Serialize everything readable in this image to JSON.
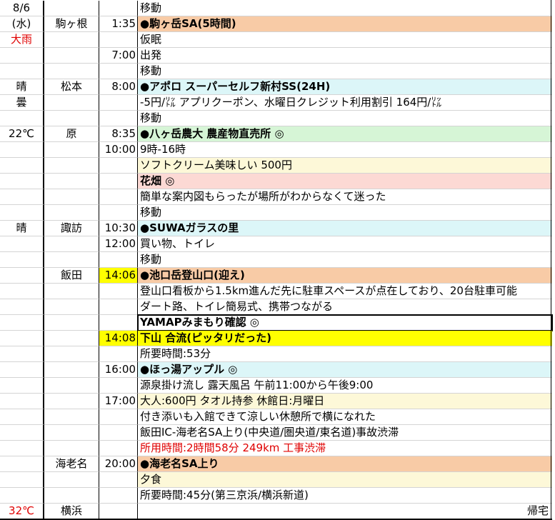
{
  "rows": [
    {
      "c1": "8/6",
      "c2": "",
      "c3": "",
      "c4": "移動",
      "bg4": "",
      "bg3": ""
    },
    {
      "c1": "(水)",
      "c2": "駒ヶ根",
      "c3": "1:35",
      "c4": "●駒ヶ岳SA(5時間)",
      "bg4": "#f8cba6",
      "bg3": "",
      "bold4": true
    },
    {
      "c1": "大雨",
      "c2": "",
      "c3": "",
      "c4": "仮眠",
      "bg4": "",
      "bg3": "",
      "red1": true
    },
    {
      "c1": "",
      "c2": "",
      "c3": "7:00",
      "c4": "出発",
      "bg4": "",
      "bg3": ""
    },
    {
      "c1": "",
      "c2": "",
      "c3": "",
      "c4": "移動",
      "bg4": "",
      "bg3": ""
    },
    {
      "c1": "晴",
      "c2": "松本",
      "c3": "8:00",
      "c4": "●アポロ スーパーセルフ新村SS(24H)",
      "bg4": "#dcf6f8",
      "bg3": "",
      "bold4": true
    },
    {
      "c1": "曇",
      "c2": "",
      "c3": "",
      "c4": "-5円/㍑ アプリクーポン、水曜日クレジット利用割引 164円/㍑",
      "bg4": "",
      "bg3": ""
    },
    {
      "c1": "",
      "c2": "",
      "c3": "",
      "c4": "移動",
      "bg4": "",
      "bg3": ""
    },
    {
      "c1": "22℃",
      "c2": "原",
      "c3": "8:35",
      "c4": "●八ヶ岳農大 農産物直売所 ◎",
      "bg4": "#d6f5d6",
      "bg3": "",
      "bold4": true
    },
    {
      "c1": "",
      "c2": "",
      "c3": "10:00",
      "c4": "9時-16時",
      "bg4": "",
      "bg3": ""
    },
    {
      "c1": "",
      "c2": "",
      "c3": "",
      "c4": "ソフトクリーム美味しい 500円",
      "bg4": "#fdf8d8",
      "bg3": ""
    },
    {
      "c1": "",
      "c2": "",
      "c3": "",
      "c4": "花畑 ◎",
      "bg4": "#fcd9d4",
      "bg3": "",
      "bold4": true
    },
    {
      "c1": "",
      "c2": "",
      "c3": "",
      "c4": "簡単な案内図もらったが場所がわからなくて迷った",
      "bg4": "",
      "bg3": ""
    },
    {
      "c1": "",
      "c2": "",
      "c3": "",
      "c4": "移動",
      "bg4": "",
      "bg3": ""
    },
    {
      "c1": "晴",
      "c2": "諏訪",
      "c3": "10:30",
      "c4": "●SUWAガラスの里",
      "bg4": "#dcf6f8",
      "bg3": "",
      "bold4": true
    },
    {
      "c1": "",
      "c2": "",
      "c3": "12:00",
      "c4": "買い物、トイレ",
      "bg4": "",
      "bg3": ""
    },
    {
      "c1": "",
      "c2": "",
      "c3": "",
      "c4": "移動",
      "bg4": "",
      "bg3": ""
    },
    {
      "c1": "",
      "c2": "飯田",
      "c3": "14:06",
      "c4": "●池口岳登山口(迎え)",
      "bg4": "#f8cba6",
      "bg3": "#ffff00",
      "bold4": true
    },
    {
      "c1": "",
      "c2": "",
      "c3": "",
      "c4": "登山口看板から1.5km進んだ先に駐車スペースが点在しており、20台駐車可能",
      "bg4": "",
      "bg3": ""
    },
    {
      "c1": "",
      "c2": "",
      "c3": "",
      "c4": "ダート路、トイレ簡易式、携帯つながる",
      "bg4": "",
      "bg3": ""
    },
    {
      "c1": "",
      "c2": "",
      "c3": "",
      "c4": "YAMAPみまもり確認 ◎",
      "bg4": "",
      "bg3": "",
      "bold4": true,
      "boxed": true
    },
    {
      "c1": "",
      "c2": "",
      "c3": "14:08",
      "c4": "下山 合流(ピッタリだった)",
      "bg4": "#ffff00",
      "bg3": "#ffff00",
      "bold4": true
    },
    {
      "c1": "",
      "c2": "",
      "c3": "",
      "c4": "所要時間:53分",
      "bg4": "",
      "bg3": ""
    },
    {
      "c1": "",
      "c2": "",
      "c3": "16:00",
      "c4": "●ほっ湯アップル ◎",
      "bg4": "#dcf6f8",
      "bg3": "",
      "bold4": true
    },
    {
      "c1": "",
      "c2": "",
      "c3": "",
      "c4": "源泉掛け流し 露天風呂 午前11:00から午後9:00",
      "bg4": "",
      "bg3": ""
    },
    {
      "c1": "",
      "c2": "",
      "c3": "17:00",
      "c4": "大人:600円 タオル持参 休館日:月曜日",
      "bg4": "#fdf8d8",
      "bg3": ""
    },
    {
      "c1": "",
      "c2": "",
      "c3": "",
      "c4": "付き添いも入館できて涼しい休憩所で横になれた",
      "bg4": "",
      "bg3": ""
    },
    {
      "c1": "",
      "c2": "",
      "c3": "",
      "c4": "飯田IC-海老名SA上り(中央道/圏央道/東名道)事故渋滞",
      "bg4": "",
      "bg3": ""
    },
    {
      "c1": "",
      "c2": "",
      "c3": "",
      "c4": "所用時間:2時間58分 249km 工事渋滞",
      "bg4": "",
      "bg3": "",
      "red4": true
    },
    {
      "c1": "",
      "c2": "海老名",
      "c3": "20:00",
      "c4": "●海老名SA上り",
      "bg4": "#f8cba6",
      "bg3": "",
      "bold4": true
    },
    {
      "c1": "",
      "c2": "",
      "c3": "",
      "c4": "夕食",
      "bg4": "#fdf8d8",
      "bg3": ""
    },
    {
      "c1": "",
      "c2": "",
      "c3": "",
      "c4": "所要時間:45分(第三京浜/横浜新道)",
      "bg4": "",
      "bg3": ""
    },
    {
      "c1": "32℃",
      "c2": "横浜",
      "c3": "",
      "c4": "",
      "bg4": "",
      "bg3": "",
      "red1": true,
      "right": "帰宅"
    }
  ]
}
